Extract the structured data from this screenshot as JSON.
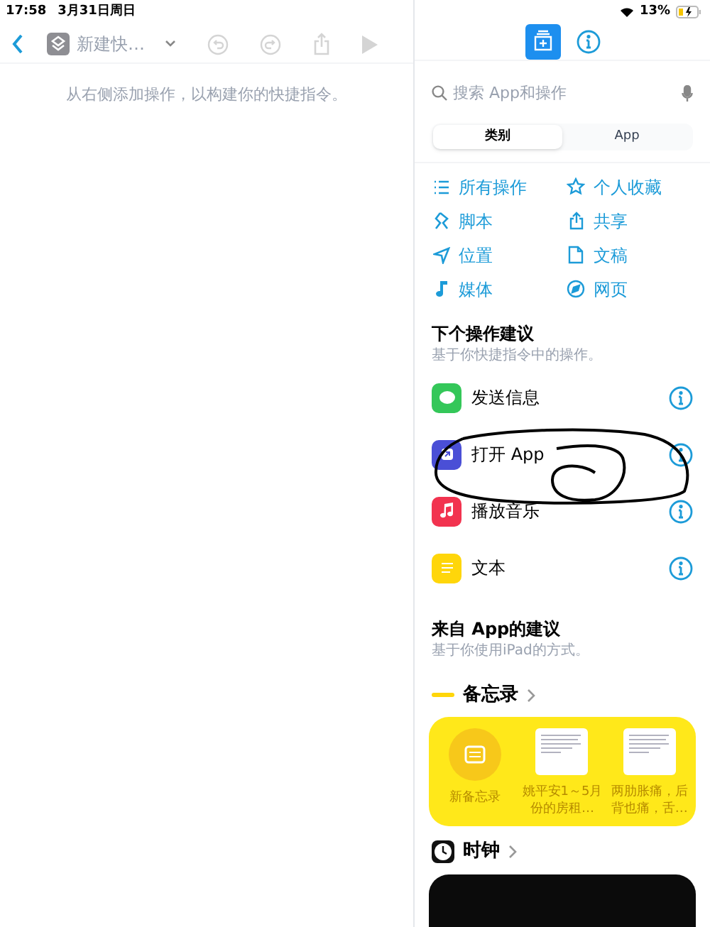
{
  "status_bar": {
    "time": "17:58",
    "date": "3月31日周日",
    "battery": "13%"
  },
  "toolbar": {
    "title": "新建快…"
  },
  "editor": {
    "hint": "从右侧添加操作，以构建你的快捷指令。"
  },
  "library": {
    "search": {
      "placeholder": "搜索 App和操作"
    },
    "segments": [
      {
        "label": "类别",
        "selected": true
      },
      {
        "label": "App",
        "selected": false
      }
    ],
    "categories": [
      {
        "label": "所有操作"
      },
      {
        "label": "个人收藏"
      },
      {
        "label": "脚本"
      },
      {
        "label": "共享"
      },
      {
        "label": "位置"
      },
      {
        "label": "文稿"
      },
      {
        "label": "媒体"
      },
      {
        "label": "网页"
      }
    ],
    "next_title": "下个操作建议",
    "next_subtitle": "基于你快捷指令中的操作。",
    "suggestions": [
      {
        "label": "发送信息",
        "color": "#34c759"
      },
      {
        "label": "打开 App",
        "color": "#4a4fd6"
      },
      {
        "label": "播放音乐",
        "color": "#f2334f"
      },
      {
        "label": "文本",
        "color": "#ffd60a"
      }
    ],
    "app_title": "来自 App的建议",
    "app_subtitle": "基于你使用iPad的方式。",
    "apps": [
      {
        "name": "备忘录",
        "kind": "notes",
        "items": [
          {
            "label": "新备忘录",
            "kind": "new"
          },
          {
            "label": "姚平安1～5月份的房租…",
            "kind": "note"
          },
          {
            "label": "两肋胀痛，后背也痛，舌…",
            "kind": "note"
          }
        ]
      },
      {
        "name": "时钟",
        "kind": "clock"
      }
    ]
  }
}
